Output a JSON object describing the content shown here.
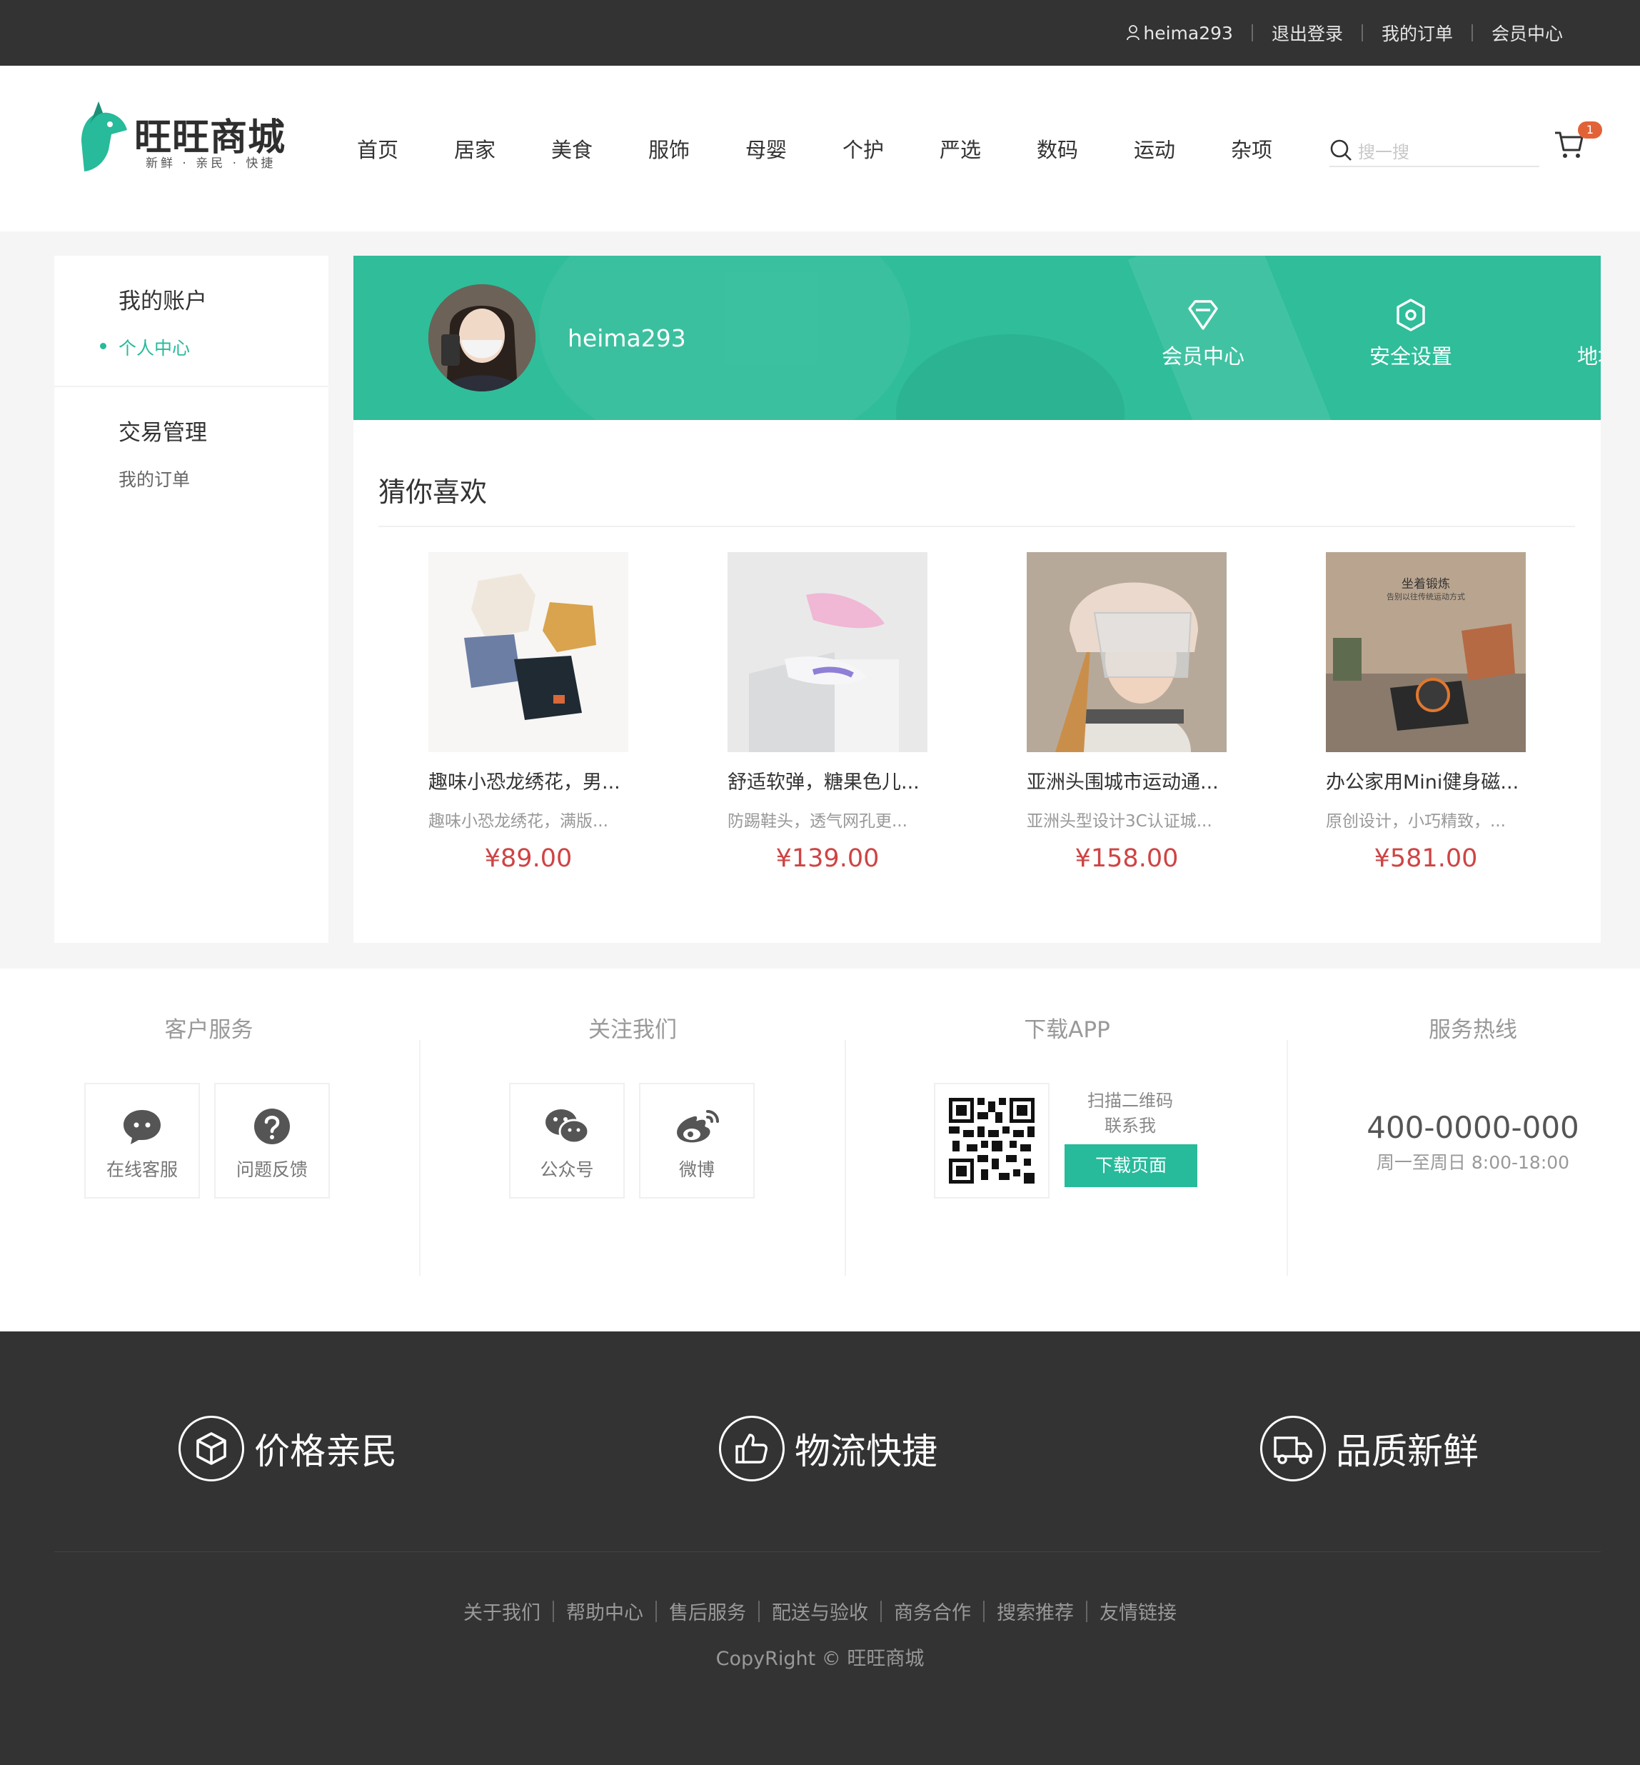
{
  "topbar": {
    "username": "heima293",
    "logout": "退出登录",
    "my_orders": "我的订单",
    "member_center": "会员中心"
  },
  "header": {
    "logo_text": "旺旺商城",
    "logo_slogan": "新鲜 · 亲民 · 快捷",
    "nav": [
      "首页",
      "居家",
      "美食",
      "服饰",
      "母婴",
      "个护",
      "严选",
      "数码",
      "运动",
      "杂项"
    ],
    "search_placeholder": "搜一搜",
    "cart_count": "1"
  },
  "sidebar": {
    "groups": [
      {
        "title": "我的账户",
        "items": [
          "个人中心"
        ]
      },
      {
        "title": "交易管理",
        "items": [
          "我的订单"
        ]
      }
    ]
  },
  "banner": {
    "username": "heima293",
    "actions": [
      {
        "label": "会员中心",
        "icon": "diamond-icon"
      },
      {
        "label": "安全设置",
        "icon": "hexagon-settings-icon"
      },
      {
        "label": "地址管理",
        "icon": "location-pin-icon"
      }
    ]
  },
  "guess": {
    "title": "猜你喜欢",
    "products": [
      {
        "name": "趣味小恐龙绣花，男...",
        "desc": "趣味小恐龙绣花，满版...",
        "price": "¥89.00"
      },
      {
        "name": "舒适软弹，糖果色儿...",
        "desc": "防踢鞋头，透气网孔更...",
        "price": "¥139.00"
      },
      {
        "name": "亚洲头围城市运动通...",
        "desc": "亚洲头型设计3C认证城...",
        "price": "¥158.00"
      },
      {
        "name": "办公家用Mini健身磁...",
        "desc": "原创设计，小巧精致，...",
        "price": "¥581.00"
      }
    ]
  },
  "product4_overlay": {
    "title": "坐着锻炼",
    "sub": "告别以往传统运动方式"
  },
  "service": {
    "customer": {
      "title": "客户服务",
      "online": "在线客服",
      "feedback": "问题反馈"
    },
    "follow": {
      "title": "关注我们",
      "wechat": "公众号",
      "weibo": "微博"
    },
    "app": {
      "title": "下载APP",
      "scan": "扫描二维码",
      "contact": "联系我",
      "button": "下载页面"
    },
    "hotline": {
      "title": "服务热线",
      "phone": "400-0000-000",
      "hours": "周一至周日 8:00-18:00"
    }
  },
  "footer": {
    "promises": [
      "价格亲民",
      "物流快捷",
      "品质新鲜"
    ],
    "links": [
      "关于我们",
      "帮助中心",
      "售后服务",
      "配送与验收",
      "商务合作",
      "搜索推荐",
      "友情链接"
    ],
    "copyright": "CopyRight © 旺旺商城"
  },
  "colors": {
    "accent": "#27ba9b",
    "price": "#cf4444",
    "topbar": "#333333",
    "badge": "#e26237"
  }
}
